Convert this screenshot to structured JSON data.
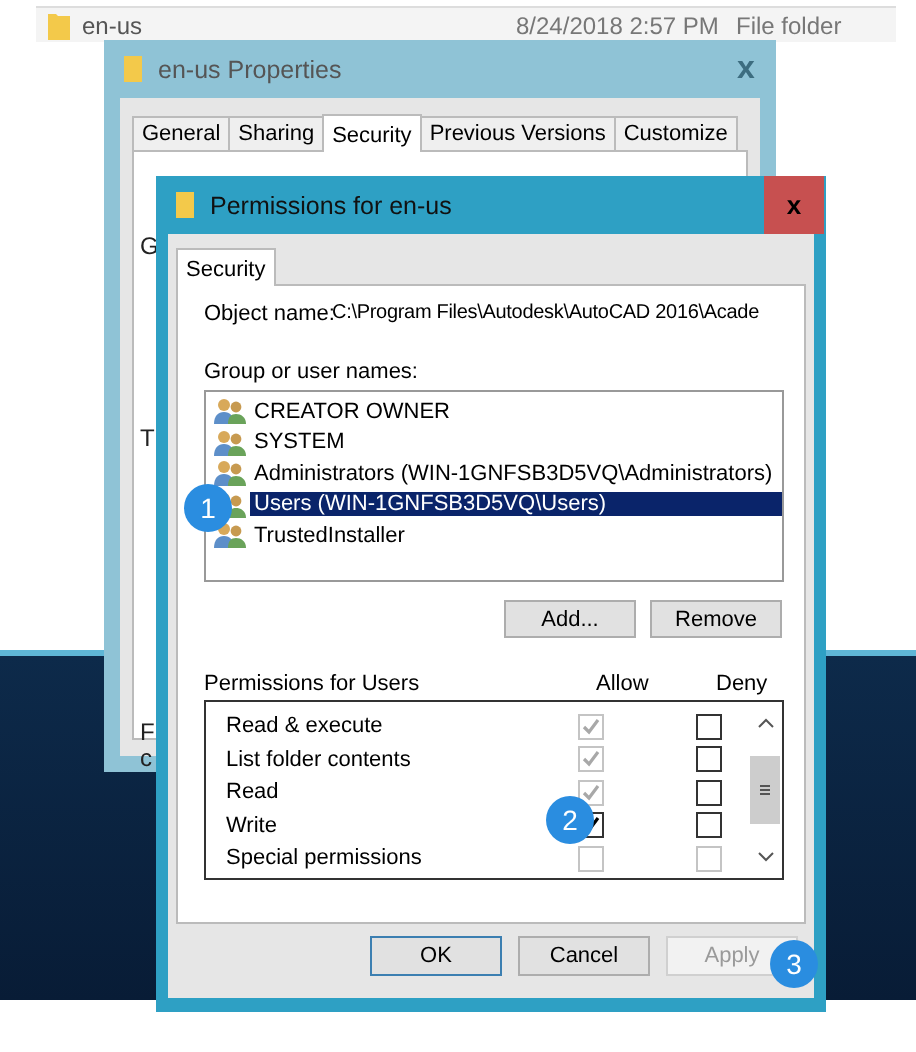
{
  "explorer_row": {
    "name": "en-us",
    "date": "8/24/2018 2:57 PM",
    "type": "File folder"
  },
  "properties_window": {
    "title": "en-us Properties",
    "close": "x",
    "tabs": [
      {
        "label": "General",
        "selected": false
      },
      {
        "label": "Sharing",
        "selected": false
      },
      {
        "label": "Security",
        "selected": true
      },
      {
        "label": "Previous Versions",
        "selected": false
      },
      {
        "label": "Customize",
        "selected": false
      }
    ],
    "covered_labels": [
      "G",
      "T",
      "F",
      "c"
    ]
  },
  "permissions_window": {
    "title": "Permissions for en-us",
    "close": "x",
    "tabs": [
      {
        "label": "Security",
        "selected": true
      }
    ],
    "object_label": "Object name:",
    "object_value": "C:\\Program Files\\Autodesk\\AutoCAD 2016\\Acade",
    "users_label": "Group or user names:",
    "users": [
      {
        "name": "CREATOR OWNER",
        "selected": false
      },
      {
        "name": "SYSTEM",
        "selected": false
      },
      {
        "name": "Administrators (WIN-1GNFSB3D5VQ\\Administrators)",
        "selected": false
      },
      {
        "name": "Users (WIN-1GNFSB3D5VQ\\Users)",
        "selected": true
      },
      {
        "name": "TrustedInstaller",
        "selected": false
      }
    ],
    "add_button": "Add...",
    "remove_button": "Remove",
    "permissions_label": "Permissions for Users",
    "allow_header": "Allow",
    "deny_header": "Deny",
    "permissions": [
      {
        "name": "Read & execute",
        "allow": {
          "checked": true,
          "disabled": true
        },
        "deny": {
          "checked": false,
          "disabled": false
        }
      },
      {
        "name": "List folder contents",
        "allow": {
          "checked": true,
          "disabled": true
        },
        "deny": {
          "checked": false,
          "disabled": false
        }
      },
      {
        "name": "Read",
        "allow": {
          "checked": true,
          "disabled": true
        },
        "deny": {
          "checked": false,
          "disabled": false
        }
      },
      {
        "name": "Write",
        "allow": {
          "checked": true,
          "disabled": false
        },
        "deny": {
          "checked": false,
          "disabled": false
        }
      },
      {
        "name": "Special permissions",
        "allow": {
          "checked": false,
          "disabled": true
        },
        "deny": {
          "checked": false,
          "disabled": true
        }
      }
    ],
    "buttons": [
      {
        "label": "OK",
        "disabled": false,
        "default": true
      },
      {
        "label": "Cancel",
        "disabled": false,
        "default": false
      },
      {
        "label": "Apply",
        "disabled": true,
        "default": false
      }
    ]
  },
  "step_badges": [
    "1",
    "2",
    "3"
  ]
}
